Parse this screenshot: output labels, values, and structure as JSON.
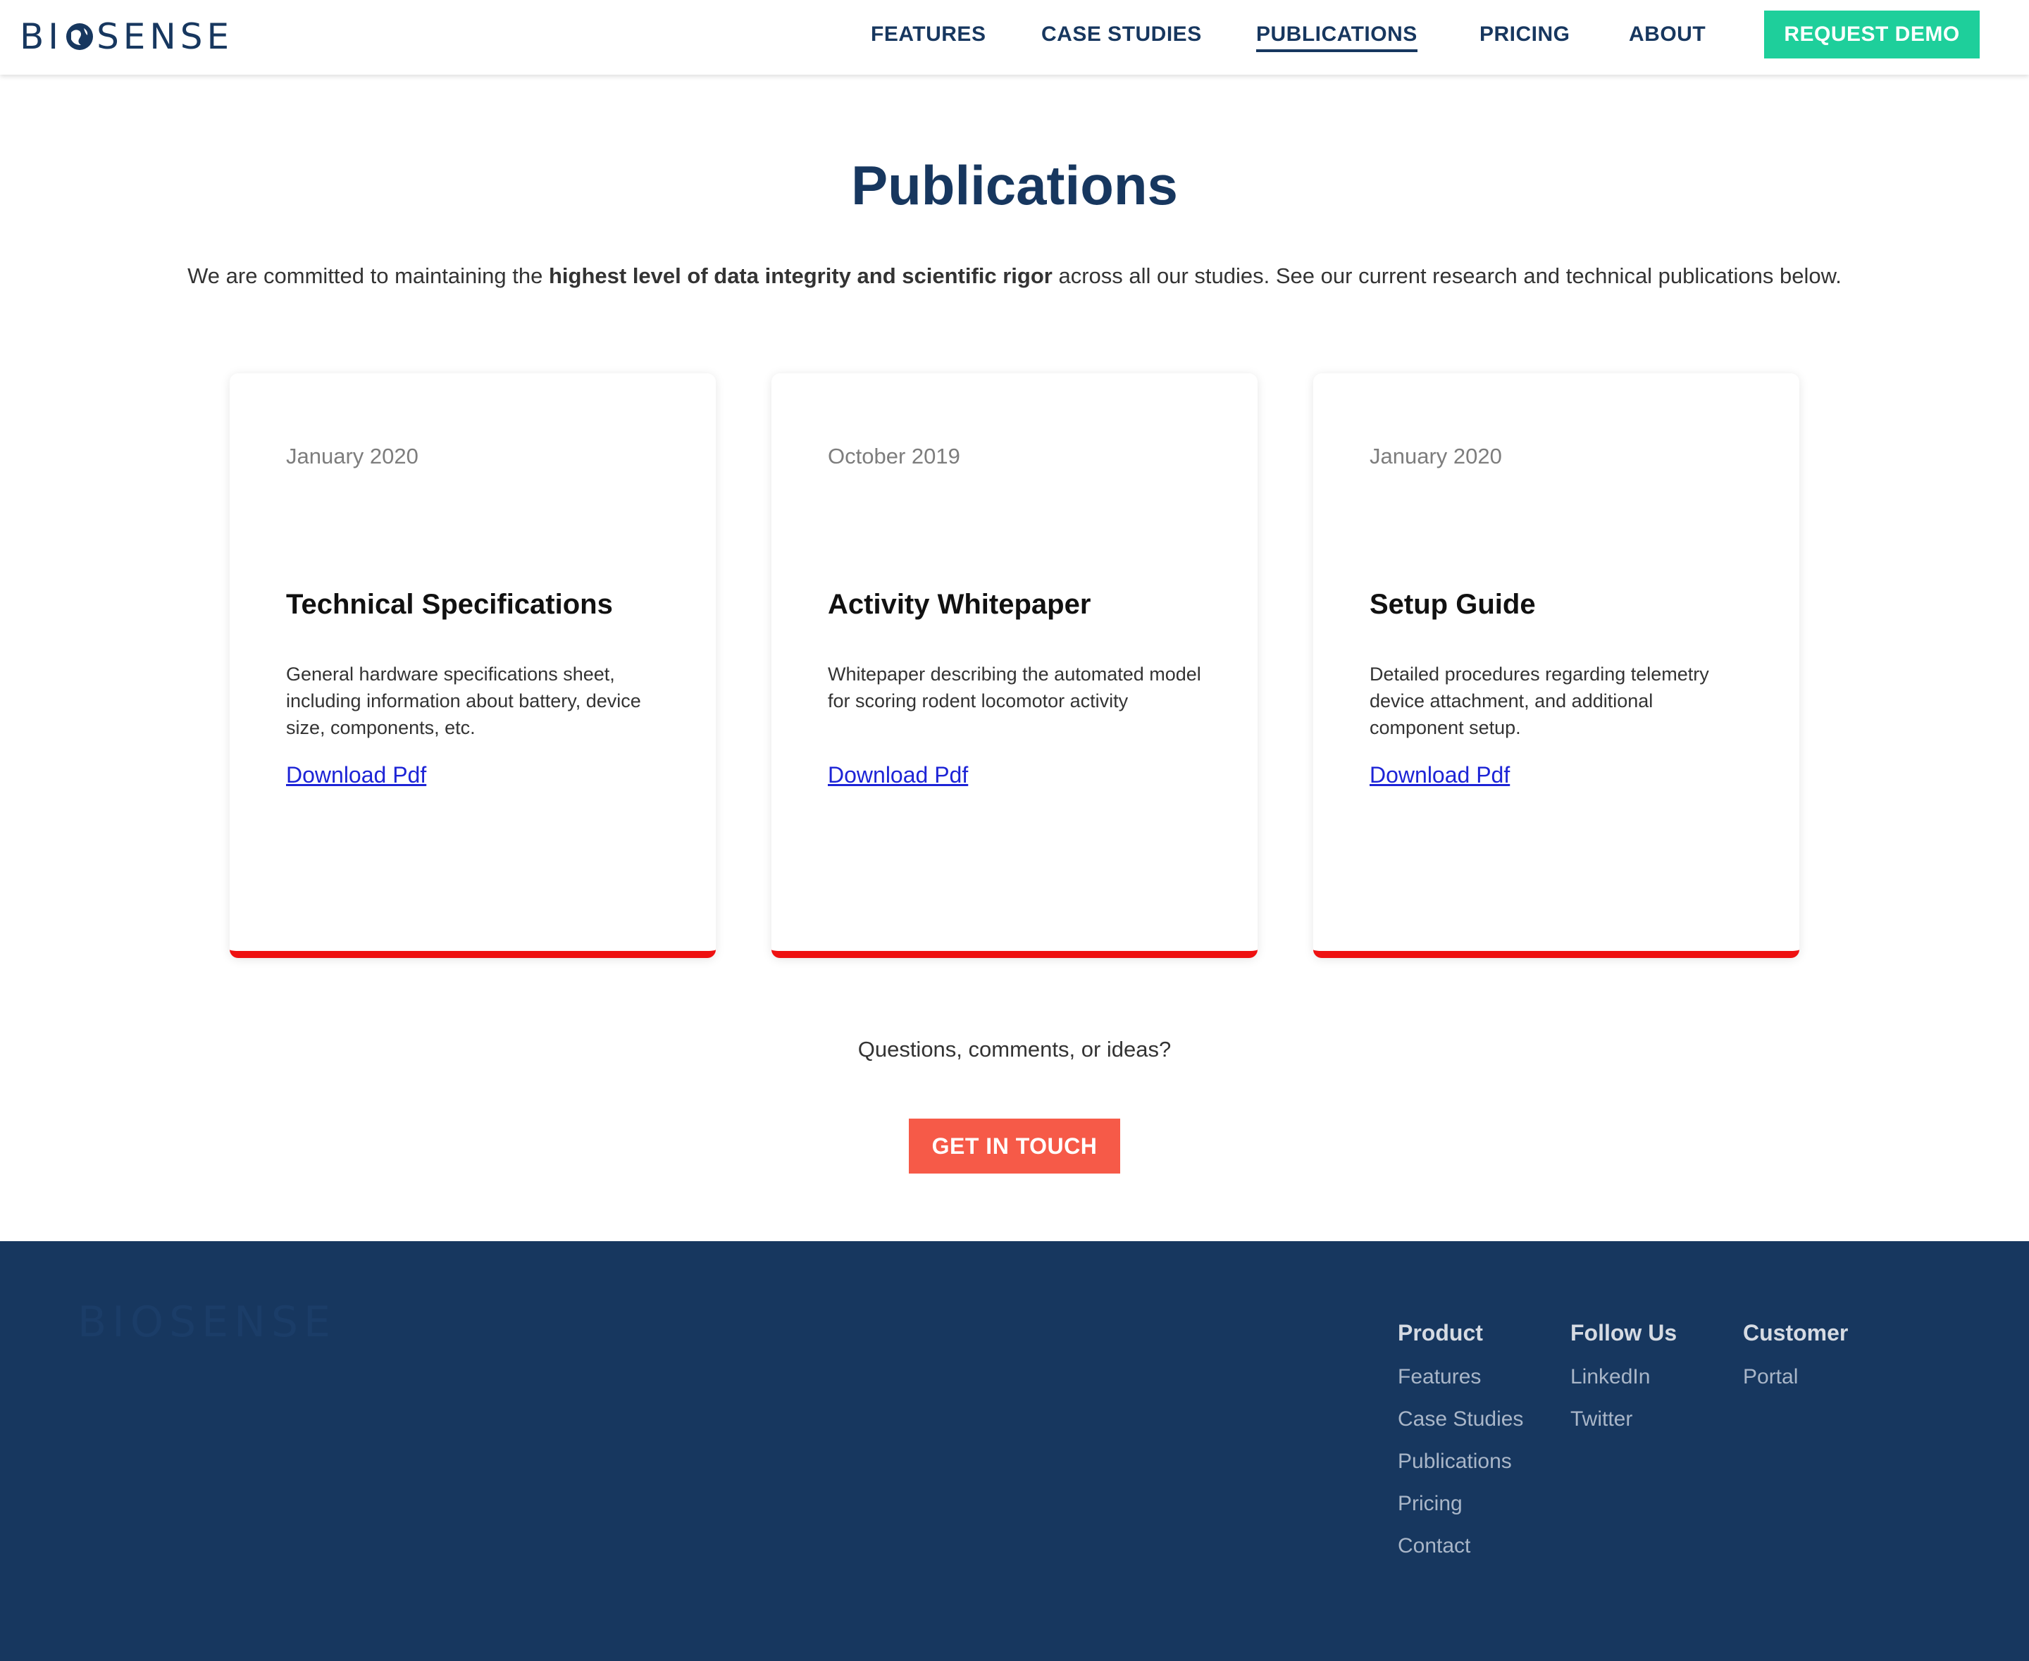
{
  "header": {
    "logo_text_left": "BI",
    "logo_text_right": "SENSE",
    "nav": [
      {
        "label": "FEATURES"
      },
      {
        "label": "CASE STUDIES"
      },
      {
        "label": "PUBLICATIONS",
        "active": true
      },
      {
        "label": "PRICING"
      },
      {
        "label": "ABOUT"
      }
    ],
    "demo_button": "REQUEST DEMO"
  },
  "main": {
    "title": "Publications",
    "intro_before": "We are committed to maintaining the ",
    "intro_bold": "highest level of data integrity and scientific rigor",
    "intro_after": " across all our studies. See our current research and technical publications below.",
    "cards": [
      {
        "date": "January 2020",
        "title": "Technical Specifications",
        "description": "General hardware specifications sheet, including information about battery, device size, components, etc.",
        "link": "Download Pdf"
      },
      {
        "date": "October 2019",
        "title": "Activity Whitepaper",
        "description": "Whitepaper describing the automated model for scoring rodent locomotor activity",
        "link": "Download Pdf"
      },
      {
        "date": "January 2020",
        "title": "Setup Guide",
        "description": "Detailed procedures regarding telemetry device attachment, and additional component setup.",
        "link": "Download Pdf"
      }
    ],
    "cta_text": "Questions, comments, or ideas?",
    "cta_button": "GET IN TOUCH"
  },
  "footer": {
    "columns": [
      {
        "heading": "Product",
        "links": [
          "Features",
          "Case Studies",
          "Publications",
          "Pricing",
          "Contact"
        ]
      },
      {
        "heading": "Follow Us",
        "links": [
          "LinkedIn",
          "Twitter"
        ]
      },
      {
        "heading": "Customer",
        "links": [
          "Portal"
        ]
      }
    ]
  },
  "colors": {
    "brand_navy": "#17375f",
    "accent_green": "#1ecf9b",
    "cta_red": "#f65a48",
    "card_border_red": "#ee1111",
    "link_blue": "#1d24d6"
  },
  "icons": {
    "logo_globe": "globe-icon"
  }
}
